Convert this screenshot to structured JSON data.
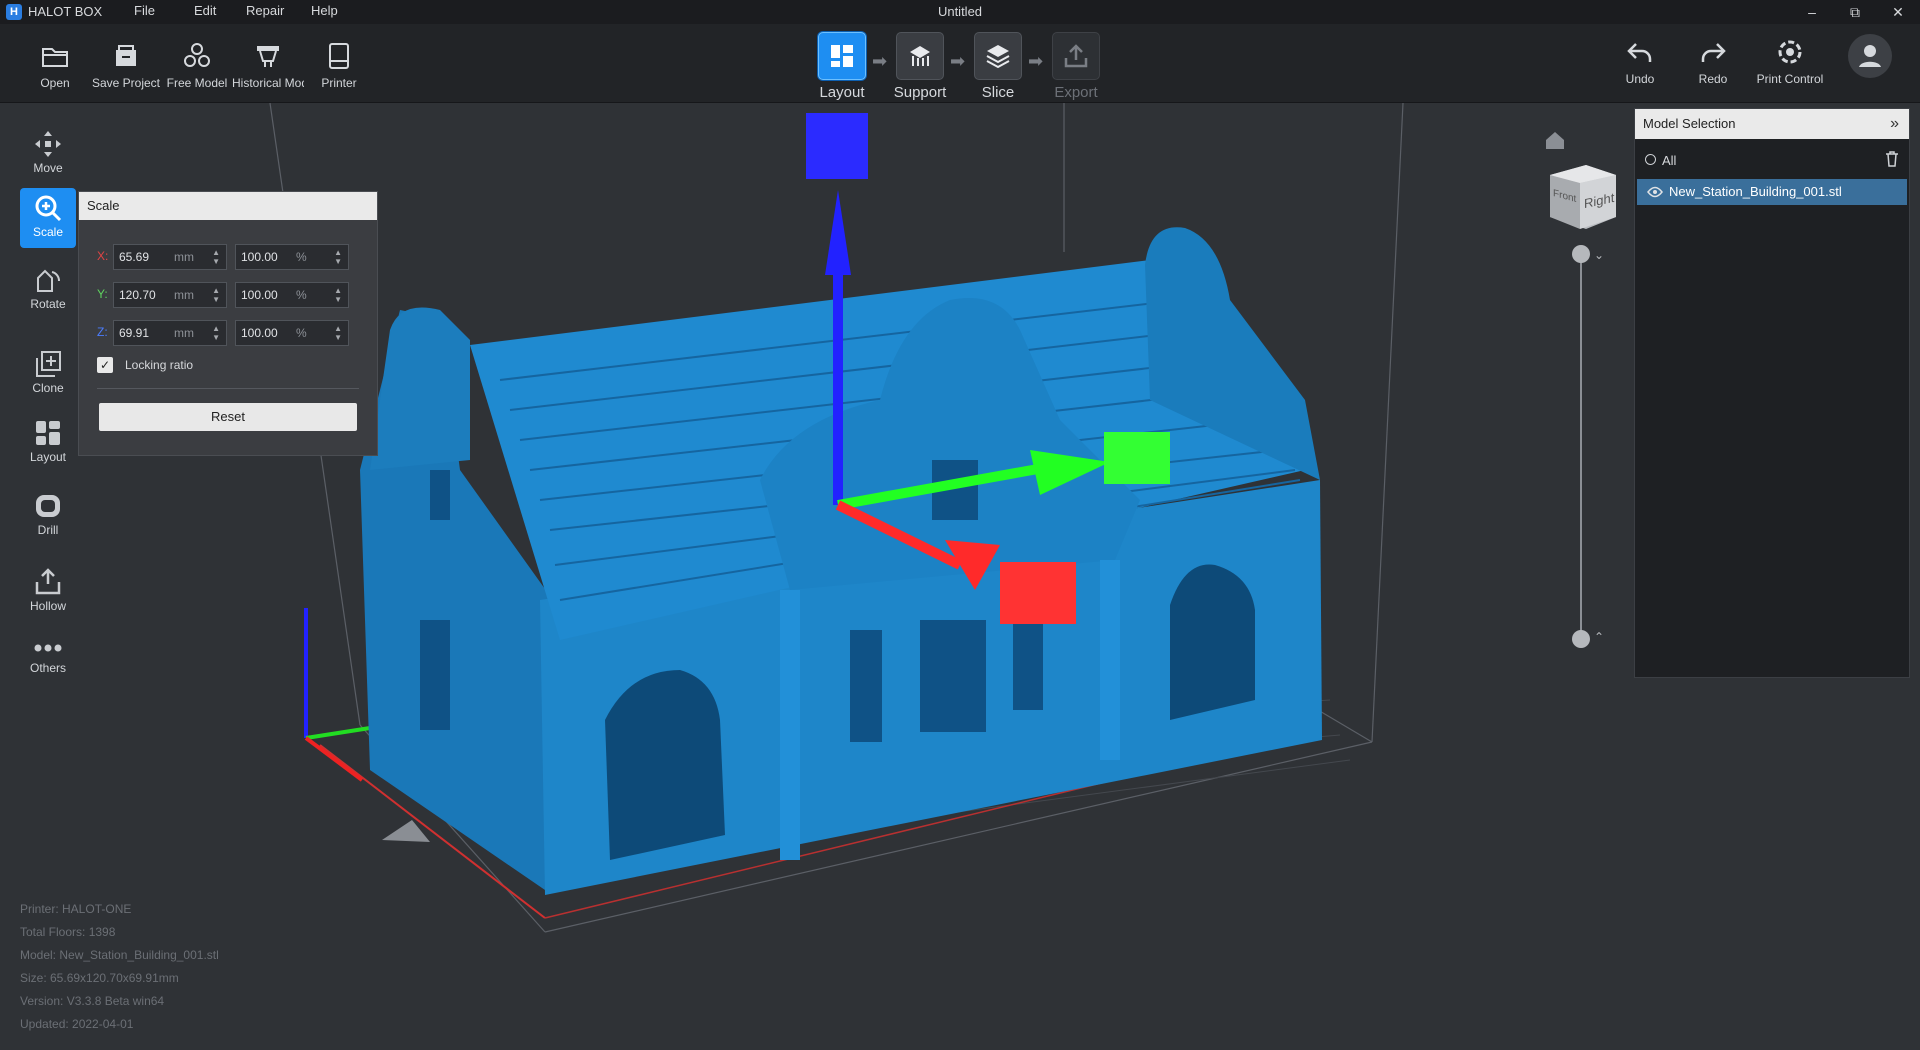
{
  "app": {
    "name": "HALOT BOX",
    "logo": "H",
    "doc_title": "Untitled"
  },
  "menu": [
    "File",
    "Edit",
    "Repair",
    "Help"
  ],
  "window_controls": {
    "minimize": "–",
    "maximize": "⧉",
    "close": "✕"
  },
  "toolbar": {
    "left": [
      {
        "label": "Open",
        "icon": "folder-open-icon"
      },
      {
        "label": "Save Project",
        "icon": "save-project-icon"
      },
      {
        "label": "Free Model",
        "icon": "free-model-icon"
      },
      {
        "label": "Historical Models",
        "icon": "historical-icon"
      },
      {
        "label": "Printer",
        "icon": "printer-icon"
      }
    ],
    "workflow": [
      {
        "label": "Layout",
        "icon": "layout-icon",
        "state": "active"
      },
      {
        "label": "Support",
        "icon": "support-icon",
        "state": "enabled"
      },
      {
        "label": "Slice",
        "icon": "slice-icon",
        "state": "enabled"
      },
      {
        "label": "Export",
        "icon": "export-icon",
        "state": "disabled"
      }
    ],
    "right": [
      {
        "label": "Undo",
        "icon": "undo-icon"
      },
      {
        "label": "Redo",
        "icon": "redo-icon"
      },
      {
        "label": "Print Control",
        "icon": "print-control-icon"
      }
    ],
    "account_icon": "user-icon"
  },
  "left_tools": [
    {
      "label": "Move",
      "icon": "move-icon"
    },
    {
      "label": "Scale",
      "icon": "scale-icon",
      "active": true
    },
    {
      "label": "Rotate",
      "icon": "rotate-icon"
    },
    {
      "label": "Clone",
      "icon": "clone-icon"
    },
    {
      "label": "Layout",
      "icon": "auto-layout-icon"
    },
    {
      "label": "Drill",
      "icon": "drill-icon"
    },
    {
      "label": "Hollow",
      "icon": "hollow-icon"
    },
    {
      "label": "Others",
      "icon": "more-icon"
    }
  ],
  "scale_panel": {
    "title": "Scale",
    "rows": [
      {
        "axis": "X:",
        "axis_color": "#e24444",
        "size": "65.69",
        "size_unit": "mm",
        "percent": "100.00",
        "percent_unit": "%"
      },
      {
        "axis": "Y:",
        "axis_color": "#5fd35f",
        "size": "120.70",
        "size_unit": "mm",
        "percent": "100.00",
        "percent_unit": "%"
      },
      {
        "axis": "Z:",
        "axis_color": "#4b7dff",
        "size": "69.91",
        "size_unit": "mm",
        "percent": "100.00",
        "percent_unit": "%"
      }
    ],
    "locking_ratio_label": "Locking ratio",
    "locking_ratio_checked": true,
    "reset_label": "Reset"
  },
  "model_panel": {
    "title": "Model Selection",
    "all_label": "All",
    "items": [
      {
        "name": "New_Station_Building_001.stl",
        "visible": true,
        "selected": true
      }
    ]
  },
  "view_cube": {
    "front": "Front",
    "right": "Right"
  },
  "layer_slider": {
    "top": 0,
    "bottom": 1
  },
  "info": {
    "printer": "Printer: HALOT-ONE",
    "floors": "Total Floors: 1398",
    "model": "Model: New_Station_Building_001.stl",
    "size": "Size: 65.69x120.70x69.91mm",
    "version": "Version: V3.3.8 Beta win64",
    "updated": "Updated:  2022-04-01"
  },
  "colors": {
    "accent": "#1e8ef2",
    "model": "#1e82c8",
    "axis_x": "#ff3232",
    "axis_y": "#32ff32",
    "axis_z": "#3232ff",
    "background": "#2f3236"
  }
}
